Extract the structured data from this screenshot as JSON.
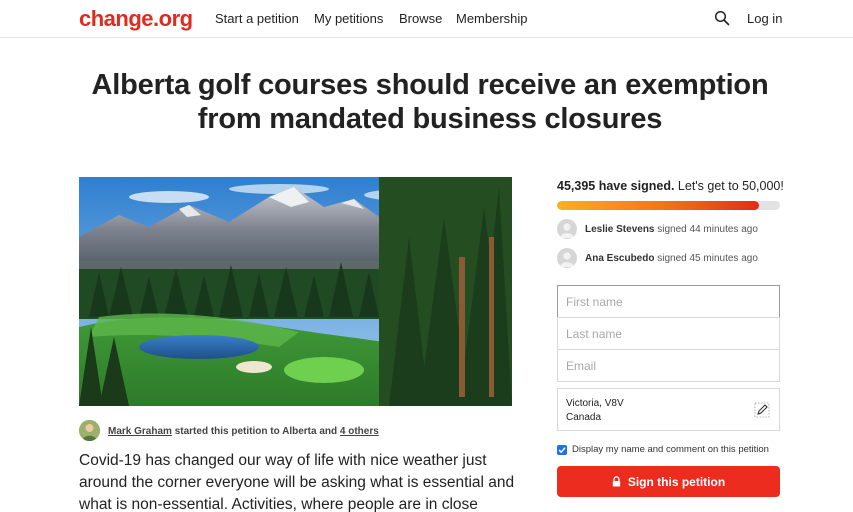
{
  "header": {
    "logo": "change.org",
    "nav": [
      "Start a petition",
      "My petitions",
      "Browse",
      "Membership"
    ],
    "search_icon": "search-icon",
    "login": "Log in"
  },
  "petition": {
    "title": "Alberta golf courses should receive an exemption from mandated business closures",
    "image_alt": "golf course with mountains",
    "author": {
      "name": "Mark Graham",
      "mid_text": "started this petition to Alberta and",
      "others": "4 others"
    },
    "body": "Covid-19 has changed our way of life with nice weather just around the corner everyone will be asking what is essential and what is non-essential. Activities, where people are in close"
  },
  "sidebar": {
    "signed_count": "45,395 have signed.",
    "goal_text": "Let's get to 50,000!",
    "progress_fraction": 0.9079,
    "recent_signers": [
      {
        "name": "Leslie Stevens",
        "action": "signed 44 minutes ago"
      },
      {
        "name": "Ana Escubedo",
        "action": "signed 45 minutes ago"
      }
    ],
    "form": {
      "first_name_placeholder": "First name",
      "last_name_placeholder": "Last name",
      "email_placeholder": "Email",
      "location_line1": "Victoria, V8V",
      "location_line2": "Canada",
      "checkbox_label": "Display my name and comment on this petition",
      "sign_button": "Sign this petition"
    }
  },
  "colors": {
    "brand": "#e02b1f",
    "button": "#ec2c1e",
    "checkbox": "#1a73e8"
  }
}
